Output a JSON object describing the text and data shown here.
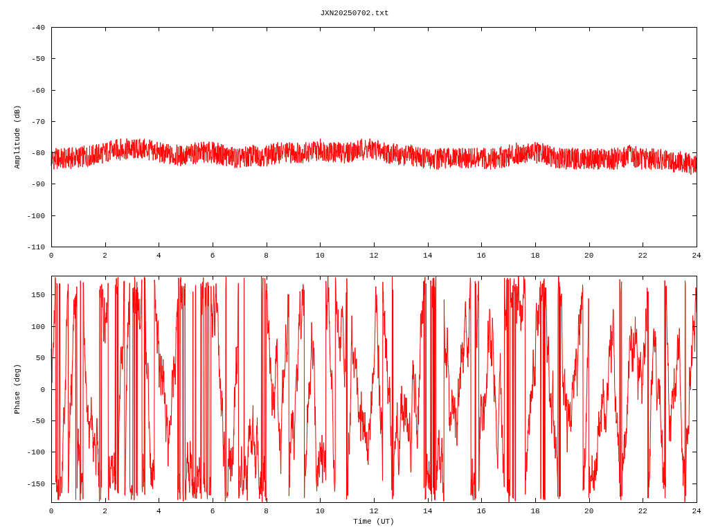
{
  "title": "JXN20250702.txt",
  "panels": [
    {
      "kind": "amplitude",
      "ylabel": "Amplitude (dB)",
      "yticks": [
        "-40",
        "-50",
        "-60",
        "-70",
        "-80",
        "-90",
        "-100",
        "-110"
      ],
      "xticks": [
        "0",
        "2",
        "4",
        "6",
        "8",
        "10",
        "12",
        "14",
        "16",
        "18",
        "20",
        "22",
        "24"
      ]
    },
    {
      "kind": "phase",
      "ylabel": "Phase (deg)",
      "xlabel": "Time (UT)",
      "yticks": [
        "150",
        "100",
        "50",
        "0",
        "-50",
        "-100",
        "-150"
      ],
      "xticks": [
        "0",
        "2",
        "4",
        "6",
        "8",
        "10",
        "12",
        "14",
        "16",
        "18",
        "20",
        "22",
        "24"
      ]
    }
  ]
}
